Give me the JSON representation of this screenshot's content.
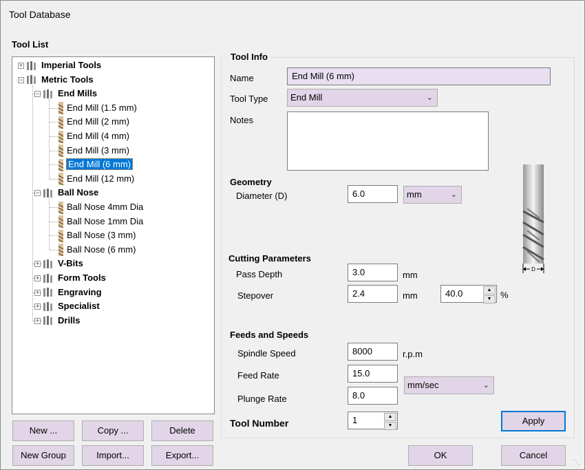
{
  "window": {
    "title": "Tool Database"
  },
  "tool_list": {
    "title": "Tool List",
    "tree": [
      {
        "label": "Imperial Tools",
        "kind": "group",
        "expanded": false
      },
      {
        "label": "Metric Tools",
        "kind": "group",
        "expanded": true
      },
      {
        "label": "End Mills",
        "kind": "group",
        "expanded": true
      },
      {
        "label": "End Mill (1.5 mm)",
        "kind": "tool"
      },
      {
        "label": "End Mill (2 mm)",
        "kind": "tool"
      },
      {
        "label": "End Mill (4 mm)",
        "kind": "tool"
      },
      {
        "label": "End Mill (3 mm)",
        "kind": "tool"
      },
      {
        "label": "End Mill (6 mm)",
        "kind": "tool",
        "selected": true
      },
      {
        "label": "End Mill (12 mm)",
        "kind": "tool"
      },
      {
        "label": "Ball Nose",
        "kind": "group",
        "expanded": true
      },
      {
        "label": "Ball Nose 4mm Dia",
        "kind": "tool"
      },
      {
        "label": "Ball Nose 1mm Dia",
        "kind": "tool"
      },
      {
        "label": "Ball Nose (3 mm)",
        "kind": "tool"
      },
      {
        "label": "Ball Nose (6 mm)",
        "kind": "tool"
      },
      {
        "label": "V-Bits",
        "kind": "group",
        "expanded": false
      },
      {
        "label": "Form Tools",
        "kind": "group",
        "expanded": false
      },
      {
        "label": "Engraving",
        "kind": "group",
        "expanded": false
      },
      {
        "label": "Specialist",
        "kind": "group",
        "expanded": false
      },
      {
        "label": "Drills",
        "kind": "group",
        "expanded": false
      }
    ],
    "buttons": {
      "new": "New ...",
      "copy": "Copy ...",
      "delete": "Delete",
      "new_group": "New Group",
      "import": "Import...",
      "export": "Export..."
    }
  },
  "tool_info": {
    "title": "Tool Info",
    "name_label": "Name",
    "name_value": "End Mill (6 mm)",
    "type_label": "Tool Type",
    "type_value": "End Mill",
    "notes_label": "Notes",
    "notes_value": ""
  },
  "geometry": {
    "title": "Geometry",
    "diameter_label": "Diameter (D)",
    "diameter_value": "6.0",
    "diameter_unit": "mm",
    "diagram_label": "D"
  },
  "cutting": {
    "title": "Cutting Parameters",
    "pass_depth_label": "Pass Depth",
    "pass_depth_value": "3.0",
    "pass_depth_unit": "mm",
    "stepover_label": "Stepover",
    "stepover_value": "2.4",
    "stepover_unit": "mm",
    "stepover_percent": "40.0",
    "percent_symbol": "%"
  },
  "feeds": {
    "title": "Feeds and Speeds",
    "spindle_label": "Spindle Speed",
    "spindle_value": "8000",
    "spindle_unit": "r.p.m",
    "feed_label": "Feed Rate",
    "feed_value": "15.0",
    "plunge_label": "Plunge Rate",
    "plunge_value": "8.0",
    "rate_unit": "mm/sec"
  },
  "tool_number": {
    "label": "Tool Number",
    "value": "1"
  },
  "footer": {
    "apply": "Apply",
    "ok": "OK",
    "cancel": "Cancel"
  },
  "colors": {
    "accent": "#0078d7",
    "button_bg": "#e1d5e7"
  }
}
